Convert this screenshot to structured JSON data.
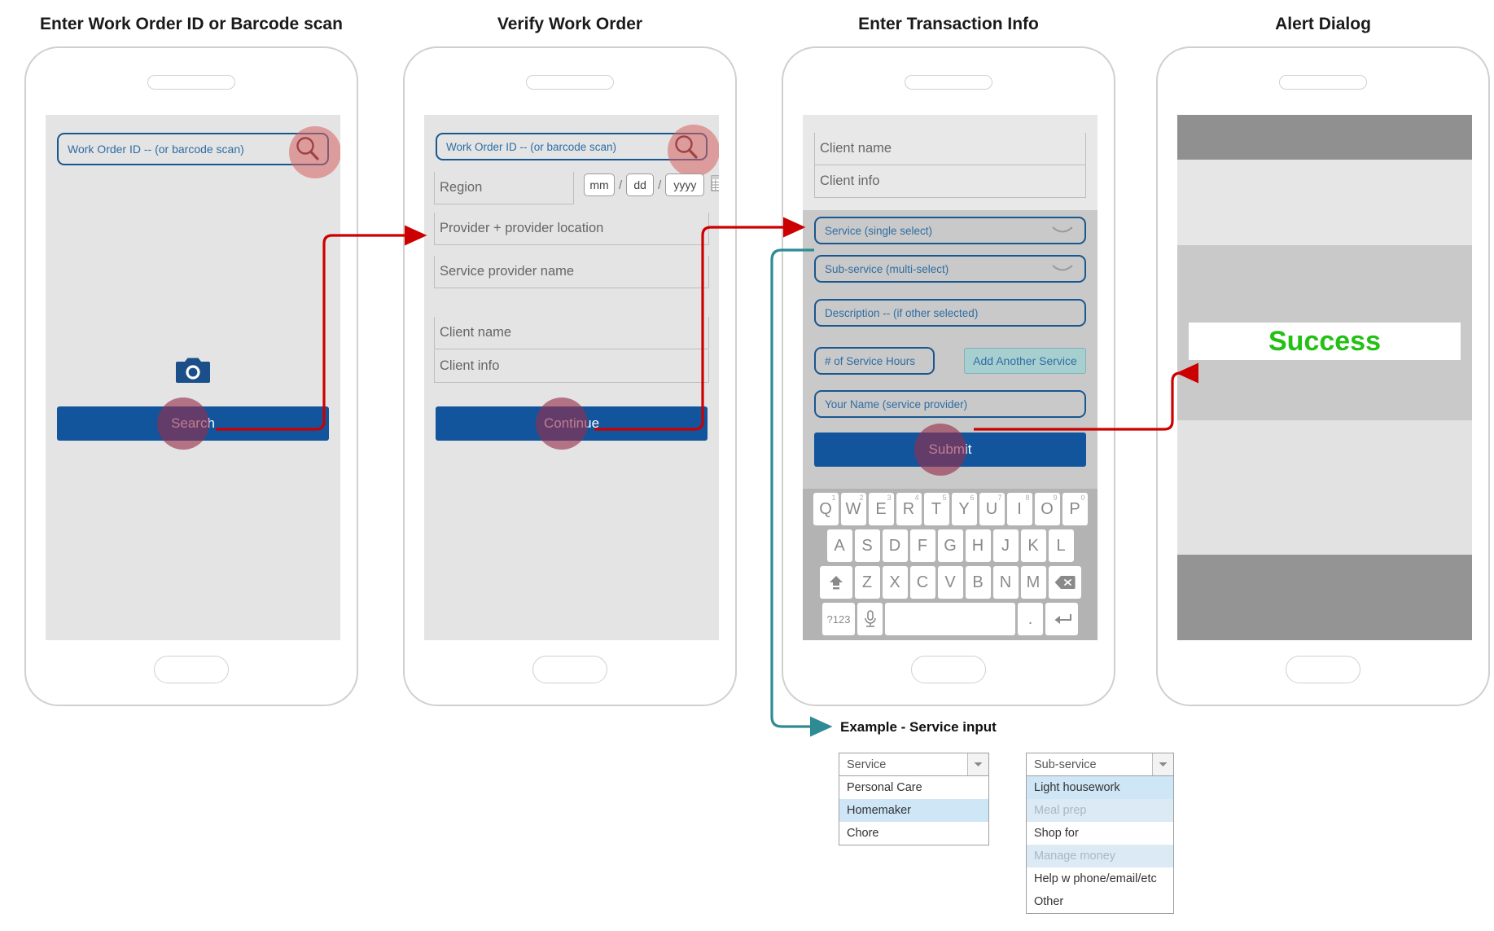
{
  "screens": [
    {
      "title": "Enter Work Order ID or Barcode scan",
      "search_input_placeholder": "Work Order ID -- (or barcode scan)",
      "search_icon": "magnifier-icon",
      "camera_icon": "camera-icon",
      "primary_button": "Search"
    },
    {
      "title": "Verify Work Order",
      "search_input_placeholder": "Work Order ID -- (or barcode scan)",
      "search_icon": "magnifier-icon",
      "region_label": "Region",
      "date_mm": "mm",
      "date_sep": "/",
      "date_dd": "dd",
      "date_yyyy": "yyyy",
      "calendar_icon": "calendar-icon",
      "provider_label": "Provider + provider location",
      "service_provider_label": "Service provider name",
      "client_name_label": "Client name",
      "client_info_label": "Client info",
      "primary_button": "Continue"
    },
    {
      "title": "Enter Transaction Info",
      "client_name_label": "Client name",
      "client_info_label": "Client info",
      "service_select": "Service (single select)",
      "subservice_select": "Sub-service (multi-select)",
      "description_input": "Description -- (if other selected)",
      "hours_input": "# of Service Hours",
      "add_service_button": "Add Another Service",
      "your_name_input": "Your Name (service provider)",
      "primary_button": "Submit"
    },
    {
      "title": "Alert Dialog",
      "success_text": "Success"
    }
  ],
  "keyboard": {
    "row1": [
      {
        "key": "Q",
        "num": "1"
      },
      {
        "key": "W",
        "num": "2"
      },
      {
        "key": "E",
        "num": "3"
      },
      {
        "key": "R",
        "num": "4"
      },
      {
        "key": "T",
        "num": "5"
      },
      {
        "key": "Y",
        "num": "6"
      },
      {
        "key": "U",
        "num": "7"
      },
      {
        "key": "I",
        "num": "8"
      },
      {
        "key": "O",
        "num": "9"
      },
      {
        "key": "P",
        "num": "0"
      }
    ],
    "row2": [
      "A",
      "S",
      "D",
      "F",
      "G",
      "H",
      "J",
      "K",
      "L"
    ],
    "row3_letters": [
      "Z",
      "X",
      "C",
      "V",
      "B",
      "N",
      "M"
    ],
    "shift_icon": "shift-up-icon",
    "backspace_icon": "backspace-icon",
    "symbols_key": "?123",
    "mic_icon": "microphone-icon",
    "space_key": "",
    "period_key": ".",
    "enter_icon": "enter-arrow-icon"
  },
  "example": {
    "label": "Example - Service input",
    "service_dropdown": {
      "header": "Service",
      "arrow_icon": "caret-down-icon",
      "options": [
        {
          "label": "Personal Care",
          "state": "normal"
        },
        {
          "label": "Homemaker",
          "state": "selected"
        },
        {
          "label": "Chore",
          "state": "normal"
        }
      ]
    },
    "subservice_dropdown": {
      "header": "Sub-service",
      "arrow_icon": "caret-down-icon",
      "options": [
        {
          "label": "Light housework",
          "state": "selected"
        },
        {
          "label": "Meal prep",
          "state": "dimmed"
        },
        {
          "label": "Shop for",
          "state": "normal"
        },
        {
          "label": "Manage money",
          "state": "dimmed"
        },
        {
          "label": "Help w phone/email/etc",
          "state": "normal"
        },
        {
          "label": "Other",
          "state": "normal"
        }
      ]
    }
  },
  "colors": {
    "primary_blue": "#12559d",
    "input_border_blue": "#19578f",
    "placeholder_blue": "#2e6da4",
    "flow_arrow_red": "#cc0000",
    "example_arrow_teal": "#2e8b94",
    "success_green": "#22c114",
    "screen_bg": "#e4e4e4",
    "teal_button": "#a8cfd0"
  }
}
